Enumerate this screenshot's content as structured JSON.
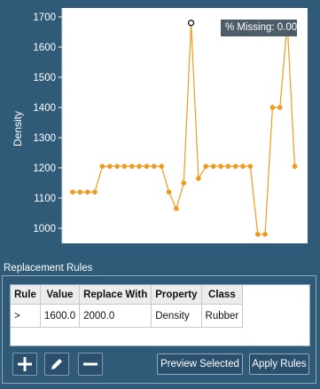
{
  "chart_data": {
    "type": "line",
    "ylabel": "Density",
    "ylim": [
      960,
      1720
    ],
    "yticks": [
      "1000",
      "1100",
      "1200",
      "1300",
      "1400",
      "1500",
      "1600",
      "1700"
    ],
    "ytick_values": [
      1000,
      1100,
      1200,
      1300,
      1400,
      1500,
      1600,
      1700
    ],
    "x": [
      0,
      1,
      2,
      3,
      4,
      5,
      6,
      7,
      8,
      9,
      10,
      11,
      12,
      13,
      14,
      15,
      16,
      17,
      18,
      19,
      20,
      21,
      22,
      23,
      24,
      25,
      26,
      27,
      28,
      29,
      30,
      31,
      32
    ],
    "series": [
      {
        "values": [
          1120,
          1120,
          1120,
          1120,
          1205,
          1205,
          1205,
          1205,
          1205,
          1205,
          1205,
          1205,
          1205,
          1120,
          1065,
          1150,
          1680,
          1165,
          1205,
          1205,
          1205,
          1205,
          1205,
          1205,
          1205,
          980,
          980,
          1400,
          1400,
          1680,
          1205
        ],
        "color": "#f09a1f",
        "highlighted_indices": [
          16,
          29
        ]
      }
    ],
    "grid": false
  },
  "badge": {
    "missing_text": "% Missing: 0.00"
  },
  "rules": {
    "title": "Replacement Rules",
    "columns": [
      "Rule",
      "Value",
      "Replace With",
      "Property",
      "Class"
    ],
    "rows": [
      [
        ">",
        "1600.0",
        "2000.0",
        "Density",
        "Rubber"
      ]
    ]
  },
  "buttons": {
    "add_icon": "plus-icon",
    "edit_icon": "pencil-icon",
    "remove_icon": "minus-icon",
    "preview_label": "Preview Selected",
    "apply_label": "Apply Rules"
  }
}
